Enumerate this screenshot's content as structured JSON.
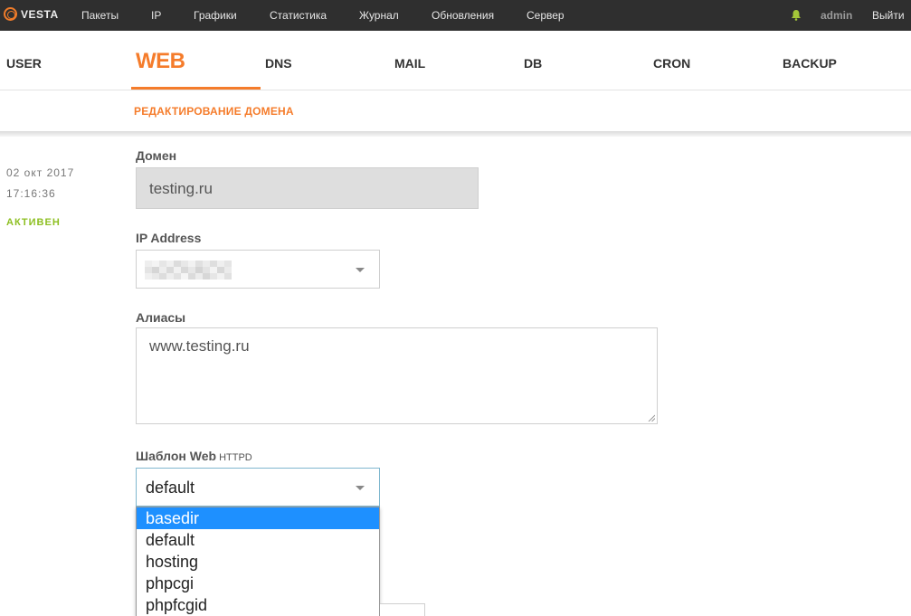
{
  "topbar": {
    "logo": "VESTA",
    "menu": [
      "Пакеты",
      "IP",
      "Графики",
      "Статистика",
      "Журнал",
      "Обновления",
      "Сервер"
    ],
    "user": "admin",
    "logout": "Выйти"
  },
  "tabs": [
    "USER",
    "WEB",
    "DNS",
    "MAIL",
    "DB",
    "CRON",
    "BACKUP"
  ],
  "active_tab": "WEB",
  "subheader": {
    "title": "РЕДАКТИРОВАНИЕ ДОМЕНА"
  },
  "meta": {
    "date": "02 окт 2017",
    "time": "17:16:36",
    "status": "АКТИВЕН"
  },
  "form": {
    "domain_label": "Домен",
    "domain_value": "testing.ru",
    "ip_label": "IP Address",
    "aliases_label": "Алиасы",
    "aliases_value": "www.testing.ru",
    "template_label": "Шаблон Web",
    "template_sub": "HTTPD",
    "template_value": "default",
    "template_options": [
      "basedir",
      "default",
      "hosting",
      "phpcgi",
      "phpfcgid"
    ],
    "template_highlighted": "basedir"
  },
  "colors": {
    "accent": "#f57c2b",
    "status": "#8dbf21",
    "highlight": "#1e90ff",
    "topbar": "#2f2f2f"
  }
}
